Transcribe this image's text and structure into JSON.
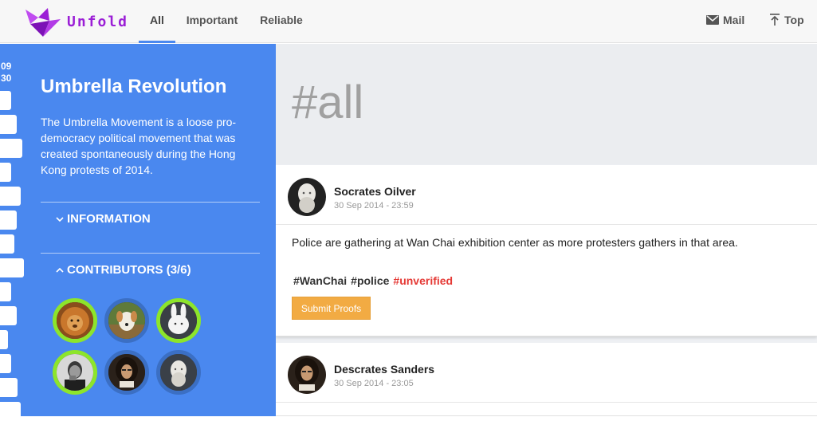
{
  "header": {
    "logo_text": "Unfold",
    "tabs": [
      {
        "label": "All",
        "active": true
      },
      {
        "label": "Important",
        "active": false
      },
      {
        "label": "Reliable",
        "active": false
      }
    ],
    "mail_label": "Mail",
    "top_label": "Top"
  },
  "timeline": {
    "date_day": "09",
    "date_month": "30"
  },
  "sidebar": {
    "title": "Umbrella Revolution",
    "description": "The Umbrella Movement is a loose pro-democracy political movement that was created spontaneously during the Hong Kong protests of 2014.",
    "information_label": "INFORMATION",
    "contributors_label": "CONTRIBUTORS (3/6)"
  },
  "feed": {
    "hashtag": "#all",
    "posts": [
      {
        "author": "Socrates Oilver",
        "time": "30 Sep 2014 - 23:59",
        "body": "Police are gathering at Wan Chai exhibition center as more protesters gathers in that area.",
        "tags": [
          "#WanChai",
          "#police",
          "#unverified"
        ],
        "button": "Submit Proofs"
      },
      {
        "author": "Descrates Sanders",
        "time": "30 Sep 2014 - 23:05"
      }
    ]
  },
  "colors": {
    "brand": "#9b1fd6",
    "sidebar": "#4a88ef",
    "contributor_active": "#8de52b",
    "button": "#f2ab43",
    "warning_tag": "#e53935"
  }
}
